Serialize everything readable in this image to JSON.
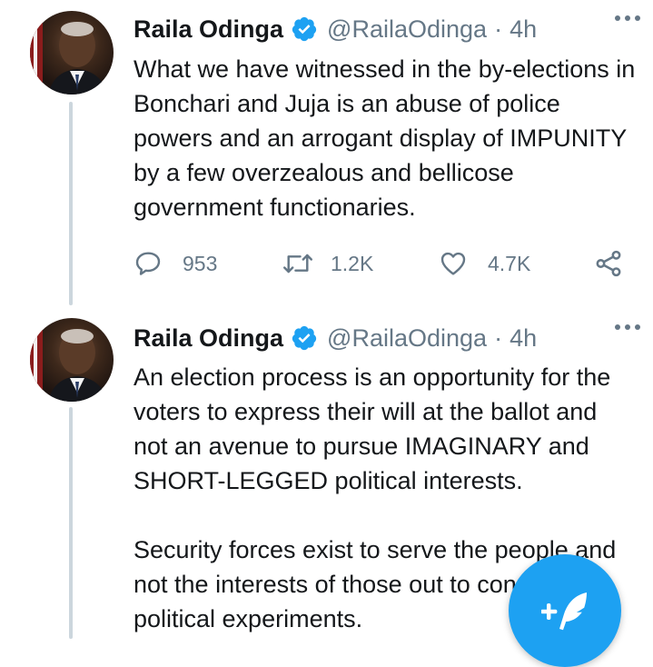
{
  "tweets": [
    {
      "author_name": "Raila Odinga",
      "handle": "@RailaOdinga",
      "separator": "·",
      "time": "4h",
      "paragraphs": [
        "What we have witnessed in the by-elections in Bonchari and Juja is an abuse of police powers and an arrogant display of IMPUNITY by a few overzealous and bellicose government functionaries."
      ],
      "reply_count": "953",
      "retweet_count": "1.2K",
      "like_count": "4.7K"
    },
    {
      "author_name": "Raila Odinga",
      "handle": "@RailaOdinga",
      "separator": "·",
      "time": "4h",
      "paragraphs": [
        "An election process is an opportunity for the voters to express their will at the ballot and not an avenue to pursue IMAGINARY and SHORT-LEGGED political interests.",
        "Security forces exist to serve the people and not the interests of those out to conduct political experiments."
      ]
    }
  ],
  "icons": {
    "verified": "verified-badge-icon",
    "more": "more-options-icon",
    "reply": "reply-icon",
    "retweet": "retweet-icon",
    "like": "heart-icon",
    "share": "share-icon",
    "compose": "compose-tweet-icon"
  },
  "colors": {
    "accent": "#1da1f2",
    "text": "#14171a",
    "secondary": "#657786",
    "thread_line": "#ccd6dd"
  }
}
